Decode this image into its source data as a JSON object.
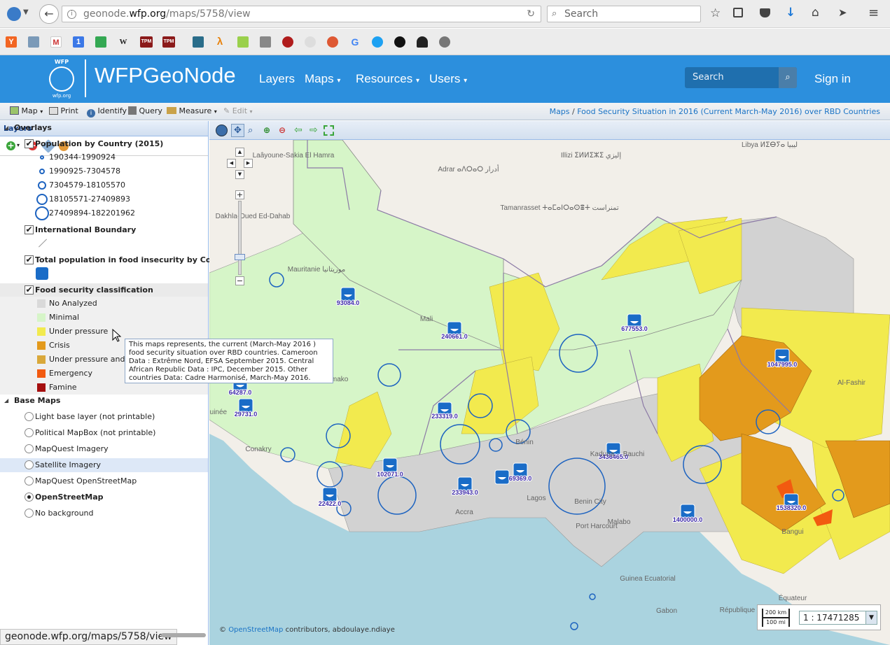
{
  "browser": {
    "url_prefix": "geonode.",
    "url_domain": "wfp.org",
    "url_rest": "/maps/5758/view",
    "search_placeholder": "Search",
    "bookmarks": [
      "Y",
      "G",
      "1",
      "W",
      "TPM",
      "TPM",
      "P",
      "λ",
      "G",
      "H"
    ]
  },
  "header": {
    "logo_text": "WFP",
    "logo_sub": "wfp.org",
    "title": "WFPGeoNode",
    "nav": [
      "Layers",
      "Maps",
      "Resources",
      "Users"
    ],
    "search_placeholder": "Search",
    "sign_in": "Sign in"
  },
  "toolbar": {
    "map": "Map",
    "print": "Print",
    "identify": "Identify",
    "query": "Query",
    "measure": "Measure",
    "edit": "Edit",
    "breadcrumb_root": "Maps",
    "breadcrumb_sep": "/",
    "breadcrumb_title": "Food Security Situation in 2016 (Current March-May 2016) over RBD Countries"
  },
  "layers_panel": {
    "title": "Layers",
    "overlays_label": "Overlays",
    "population_title": "Population by Country (2015)",
    "population_classes": [
      "190344-1990924",
      "1990925-7304578",
      "7304579-18105570",
      "18105571-27409893",
      "27409894-182201962"
    ],
    "boundary_title": "International Boundary",
    "food_insecurity_title": "Total population in food insecurity by Country",
    "classification_title": "Food security classification",
    "classification_items": [
      {
        "label": "No Analyzed",
        "color": "#d9d9d9"
      },
      {
        "label": "Minimal",
        "color": "#d6f5c8"
      },
      {
        "label": "Under pressure",
        "color": "#f2ea4e"
      },
      {
        "label": "Crisis",
        "color": "#e39a1c"
      },
      {
        "label": "Under pressure and Crisis",
        "color": "#d9a83a"
      },
      {
        "label": "Emergency",
        "color": "#f25a10"
      },
      {
        "label": "Famine",
        "color": "#a50f0f"
      }
    ],
    "base_maps_label": "Base Maps",
    "base_maps": [
      "Light base layer (not printable)",
      "Political MapBox (not printable)",
      "MapQuest Imagery",
      "Satellite Imagery",
      "MapQuest OpenStreetMap",
      "OpenStreetMap",
      "No background"
    ],
    "selected_base_map": "OpenStreetMap"
  },
  "tooltip": {
    "text": "This maps represents, the current (March-May 2016 ) food security situation over RBD countries. Cameroon Data : Extrême Nord, EFSA September 2015. Central African Republic Data : IPC, December 2015. Other countries Data: Cadre Harmonisé, March-May 2016."
  },
  "map": {
    "place_labels": [
      "Laâyoune-Sakia El Hamra",
      "Adrar ⴰⴷⵔⴰⵔ أدرار",
      "Illizi ⵉⵍⵍⵉⵣⵉ إليزي",
      "Libya ⵍⵉⴱⵢⴰ ليبيا",
      "Tamanrasset ⵜⴰⵎⴰⵏⵔⴰⵙⴻⵜ تمنراست",
      "Dakhla-Oued Ed-Dahab",
      "Mauritanie موريتانيا",
      "Mali",
      "Bamako",
      "Conakry",
      "Guinée",
      "Lagos",
      "Accra",
      "Bénin",
      "Malabo",
      "Guinea Ecuatorial",
      "Gabon",
      "République du Congo",
      "Al-Fashir",
      "Bangui",
      "Équateur",
      "Kaduna",
      "Bauchi",
      "Benin City",
      "Port Harcourt"
    ],
    "values": [
      "93084.0",
      "240661.0",
      "677553.0",
      "1047995.0",
      "64287.0",
      "29731.0",
      "233319.0",
      "3436465.0",
      "102071.0",
      "69369.0",
      "233943.0",
      "22422.0",
      "1400000.0",
      "1538320.0"
    ],
    "attribution_prefix": "©",
    "attribution_link": "OpenStreetMap",
    "attribution_suffix": "contributors, abdoulaye.ndiaye",
    "scale_km": "200 km",
    "scale_mi": "100 mi",
    "scale_ratio": "1 : 17471285"
  },
  "status_bar": "geonode.wfp.org/maps/5758/view",
  "colors": {
    "header_blue": "#2c8fdd",
    "minimal": "#d6f5c8",
    "under_pressure": "#f2ea4e",
    "crisis": "#e39a1c",
    "emergency": "#f25a10",
    "no_analyzed": "#d2d2d2",
    "water": "#aad3df"
  }
}
